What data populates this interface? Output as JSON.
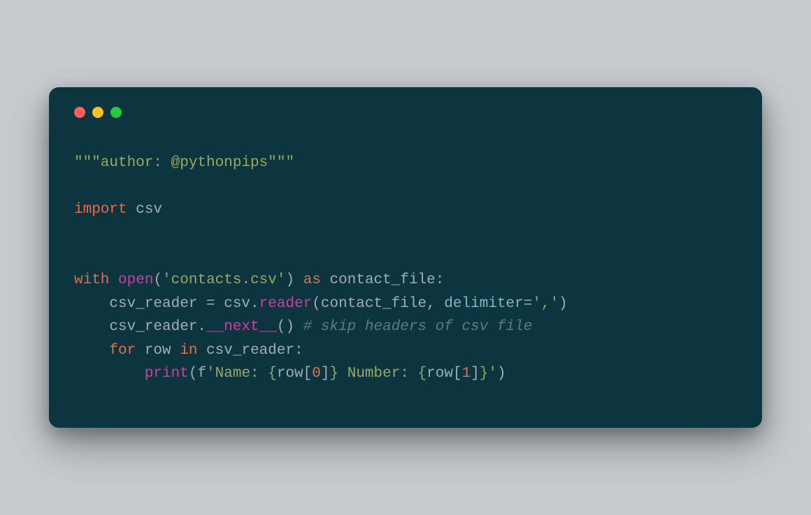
{
  "window": {
    "traffic_lights": {
      "red": "#ff5f56",
      "yellow": "#ffbd2e",
      "green": "#27c93f"
    }
  },
  "code": {
    "line1": {
      "docstring": "\"\"\"author: @pythonpips\"\"\""
    },
    "line3": {
      "kw_import": "import",
      "mod": " csv"
    },
    "line6": {
      "kw_with": "with",
      "space1": " ",
      "fn_open": "open",
      "lparen": "(",
      "str_file": "'contacts.csv'",
      "rparen": ")",
      "space2": " ",
      "kw_as": "as",
      "var": " contact_file:",
      "colon": ""
    },
    "line7": {
      "text1": "csv_reader = csv.",
      "fn_reader": "reader",
      "lparen": "(",
      "args": "contact_file, ",
      "param": "delimiter",
      "eq": "=",
      "str_delim": "','",
      "rparen": ")"
    },
    "line8": {
      "text1": "csv_reader.",
      "fn_next": "__next__",
      "parens": "() ",
      "comment": "# skip headers of csv file"
    },
    "line9": {
      "kw_for": "for",
      "var_row": " row ",
      "kw_in": "in",
      "var_reader": " csv_reader:"
    },
    "line10": {
      "fn_print": "print",
      "lparen": "(",
      "fprefix": "f",
      "str_open": "'Name: ",
      "brace_o1": "{",
      "expr1a": "row[",
      "num0": "0",
      "expr1b": "]",
      "brace_c1": "}",
      "str_mid": " Number: ",
      "brace_o2": "{",
      "expr2a": "row[",
      "num1": "1",
      "expr2b": "]",
      "brace_c2": "}",
      "str_close": "'",
      "rparen": ")"
    }
  }
}
